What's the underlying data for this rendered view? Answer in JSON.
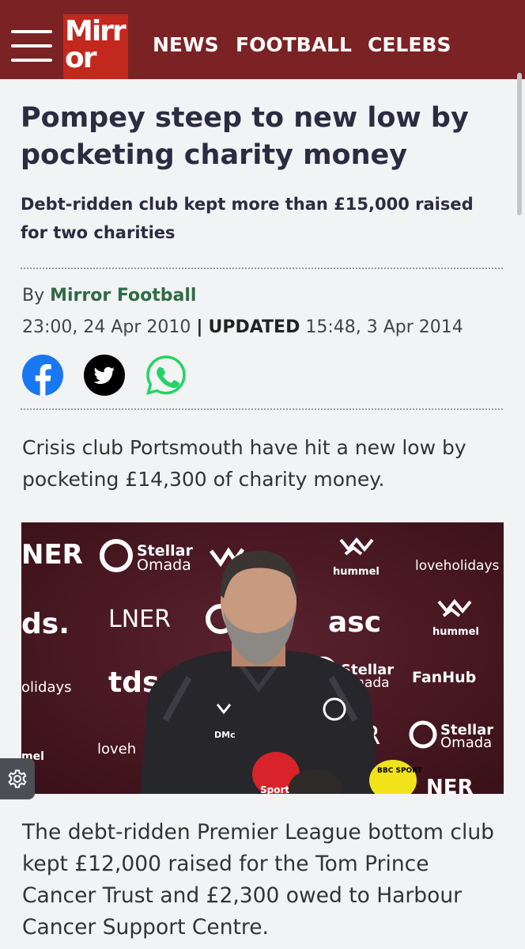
{
  "header": {
    "logo": {
      "line1": "Mirr",
      "line2": "or"
    },
    "nav": [
      {
        "label": "NEWS"
      },
      {
        "label": "FOOTBALL"
      },
      {
        "label": "CELEBS"
      }
    ],
    "menu_icon": "hamburger-icon"
  },
  "article": {
    "headline": "Pompey steep to new low by pocketing charity money",
    "subheadline": "Debt-ridden club kept more than £15,000 raised for two charities",
    "byline": {
      "prefix": "By",
      "author": "Mirror Football"
    },
    "dateline": {
      "published": "23:00, 24 Apr 2010",
      "separator": "|",
      "updated_label": "UPDATED",
      "updated": "15:48, 3 Apr 2014"
    },
    "share": [
      {
        "icon": "facebook-icon",
        "color": "#1877f2"
      },
      {
        "icon": "twitter-icon",
        "color": "#000000"
      },
      {
        "icon": "whatsapp-icon",
        "color": "#25d366"
      }
    ],
    "paragraphs": [
      "Crisis club Portsmouth have hit a new low by pocketing £14,300 of charity money.",
      "The debt-ridden Premier League bottom club kept £12,000 raised for the Tom Prince Cancer Trust and £2,300 owed to Harbour Cancer Support Centre."
    ],
    "photo": {
      "backdrop_logos": [
        "NER",
        "Stellar",
        "Omada",
        "hummel",
        "loveholidays",
        "ds.",
        "LNER",
        "asc",
        "hummel",
        "olidays",
        "tds",
        "Stellar",
        "Omada",
        "FanHub",
        "mel",
        "loveh",
        "R",
        "Stellar",
        "Omada",
        "NER"
      ],
      "shirt_text": "DMc",
      "mic_labels": [
        "Sport",
        "BBC SPORT"
      ]
    }
  },
  "settings_icon": "gear-icon",
  "colors": {
    "header_bg": "#7b2224",
    "logo_bg": "#c2281e",
    "headline": "#2b2b42",
    "author": "#2f6b45",
    "page_bg": "#f2f3f4"
  }
}
